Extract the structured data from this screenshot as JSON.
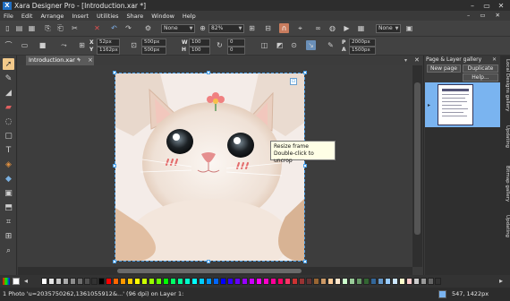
{
  "app": {
    "title": "Xara Designer Pro - [Introduction.xar *]",
    "logo": "X"
  },
  "menu": [
    "File",
    "Edit",
    "Arrange",
    "Insert",
    "Utilities",
    "Share",
    "Window",
    "Help"
  ],
  "toolbar": {
    "quality_select": "None",
    "zoom_select": "82%",
    "line_select": "None"
  },
  "infobar": {
    "x_label": "X",
    "x_value": "52px",
    "y_label": "Y",
    "y_value": "1162px",
    "w_label": "W",
    "w_value": "500px",
    "h_label": "H",
    "h_value": "500px",
    "w2_value": "100",
    "h2_value": "100",
    "rotate_value": "0",
    "skew_value": "0",
    "p_label": "P",
    "p_value": "2000px",
    "a_label": "A",
    "a_value": "1500px"
  },
  "document": {
    "tab_label": "Introduction.xar *",
    "pin": "▾",
    "close": "×"
  },
  "tooltip": {
    "line1": "Resize frame",
    "line2": "Double-click to uncrop"
  },
  "gallery": {
    "title": "Page & Layer gallery",
    "new_page": "New page",
    "duplicate": "Duplicate",
    "help": "Help..."
  },
  "side_tabs": [
    "Local Designs gallery",
    "Updating",
    "Bitmap gallery",
    "Updating"
  ],
  "status": {
    "text": "1 Photo 'u=2035750262,1361055912&...' (96 dpi) on Layer 1:",
    "coords": "547, 1422px"
  },
  "colors": {
    "accent": "#4aa0e8",
    "selection": "#7ab4f0",
    "tooltip_bg": "#ffffe6"
  },
  "palette": [
    "#ffffff",
    "#e6e6e6",
    "#c8c8c8",
    "#aaaaaa",
    "#8c8c8c",
    "#6e6e6e",
    "#505050",
    "#323232",
    "#000000",
    "#ff0000",
    "#ff6600",
    "#ff9900",
    "#ffcc00",
    "#ffff00",
    "#ccff00",
    "#99ff00",
    "#66ff00",
    "#00ff00",
    "#00ff66",
    "#00ff99",
    "#00ffcc",
    "#00ffff",
    "#00ccff",
    "#0099ff",
    "#0066ff",
    "#0000ff",
    "#3300ff",
    "#6600ff",
    "#9900ff",
    "#cc00ff",
    "#ff00ff",
    "#ff00cc",
    "#ff0099",
    "#ff0066",
    "#ff3366",
    "#cc3333",
    "#993333",
    "#663333",
    "#996633",
    "#cc9966",
    "#ffcc99",
    "#ffe6cc",
    "#ccffcc",
    "#99cc99",
    "#669966",
    "#336633",
    "#336699",
    "#6699cc",
    "#99ccff",
    "#cce6ff",
    "#ffffcc",
    "#ffcccc",
    "#cccccc",
    "#999999",
    "#666666",
    "#333333"
  ]
}
